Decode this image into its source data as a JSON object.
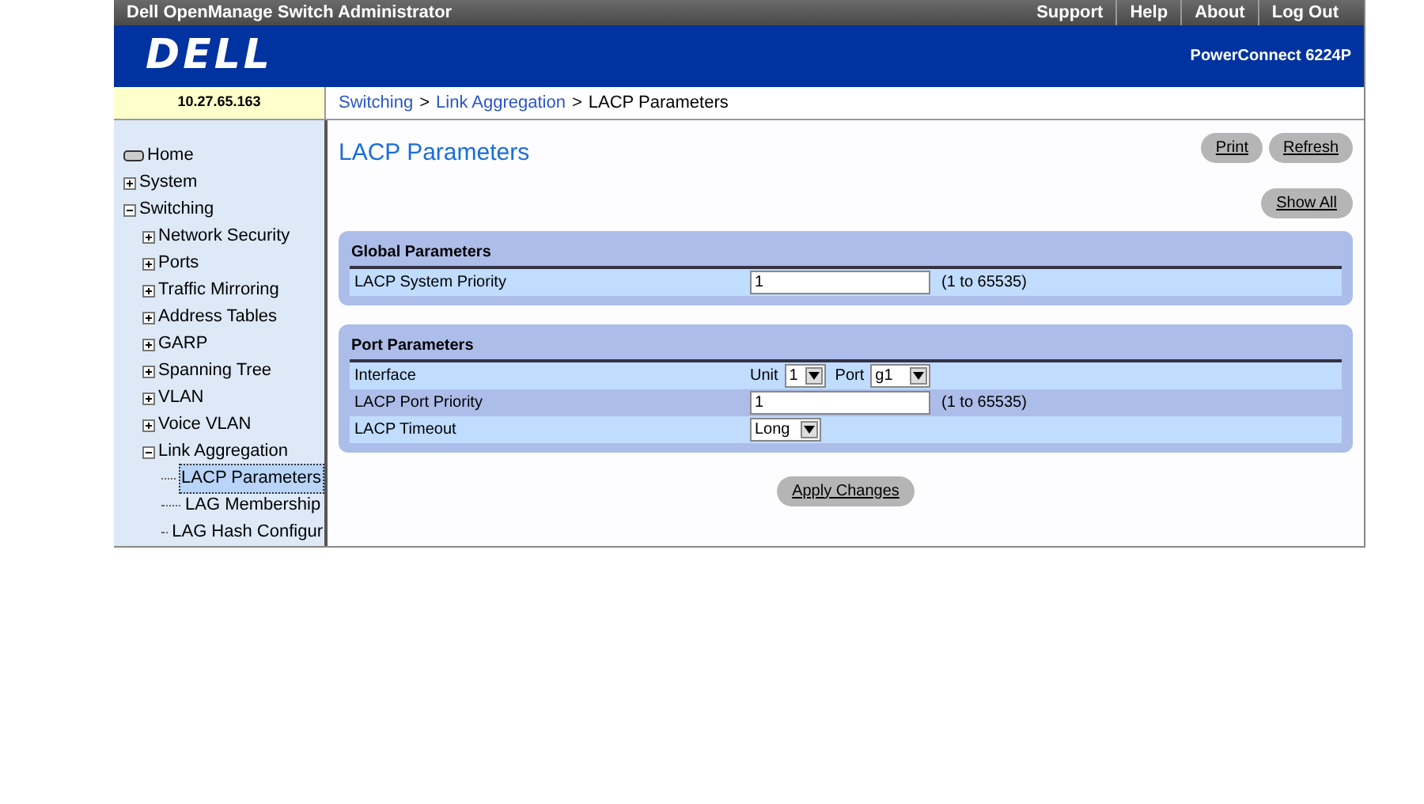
{
  "header": {
    "title": "Dell OpenManage Switch Administrator",
    "links": [
      "Support",
      "Help",
      "About",
      "Log Out"
    ],
    "model": "PowerConnect 6224P",
    "logo": "DELL"
  },
  "ip": "10.27.65.163",
  "breadcrumb": [
    {
      "kind": "link",
      "label": "Switching"
    },
    {
      "kind": "separator",
      "label": ">"
    },
    {
      "kind": "link",
      "label": "Link Aggregation"
    },
    {
      "kind": "separator",
      "label": ">"
    },
    {
      "kind": "current",
      "label": "LACP Parameters"
    }
  ],
  "tree": [
    {
      "label": "Home",
      "kind": "home",
      "selected": false
    },
    {
      "label": "System",
      "kind": "folder",
      "expanded": false,
      "selected": false
    },
    {
      "label": "Switching",
      "kind": "folder",
      "expanded": true,
      "selected": false,
      "children": [
        {
          "label": "Network Security",
          "kind": "folder",
          "expanded": false,
          "selected": false
        },
        {
          "label": "Ports",
          "kind": "folder",
          "expanded": false,
          "selected": false
        },
        {
          "label": "Traffic Mirroring",
          "kind": "folder",
          "expanded": false,
          "selected": false
        },
        {
          "label": "Address Tables",
          "kind": "folder",
          "expanded": false,
          "selected": false
        },
        {
          "label": "GARP",
          "kind": "folder",
          "expanded": false,
          "selected": false
        },
        {
          "label": "Spanning Tree",
          "kind": "folder",
          "expanded": false,
          "selected": false
        },
        {
          "label": "VLAN",
          "kind": "folder",
          "expanded": false,
          "selected": false
        },
        {
          "label": "Voice VLAN",
          "kind": "folder",
          "expanded": false,
          "selected": false
        },
        {
          "label": "Link Aggregation",
          "kind": "folder",
          "expanded": true,
          "selected": false,
          "children": [
            {
              "label": "LACP Parameters",
              "kind": "page",
              "selected": true
            },
            {
              "label": "LAG Membership",
              "kind": "page",
              "selected": false
            },
            {
              "label": "LAG Hash Configur",
              "kind": "page",
              "selected": false
            }
          ]
        }
      ]
    }
  ],
  "page_title": "LACP Parameters",
  "top_buttons": [
    "Print",
    "Refresh"
  ],
  "show_all": "Show All",
  "panels": [
    {
      "title": "Global Parameters",
      "rows": [
        {
          "kind": "text",
          "label": "LACP System Priority",
          "value": "1",
          "hint": "(1 to 65535)"
        }
      ]
    },
    {
      "title": "Port Parameters",
      "rows": [
        {
          "kind": "interface",
          "label": "Interface",
          "unit_label": "Unit",
          "unit": "1",
          "port_label": "Port",
          "port": "g1"
        },
        {
          "kind": "text",
          "label": "LACP Port Priority",
          "value": "1",
          "hint": "(1 to 65535)"
        },
        {
          "kind": "select",
          "label": "LACP Timeout",
          "value": "Long"
        }
      ]
    }
  ],
  "apply_button": "Apply Changes"
}
